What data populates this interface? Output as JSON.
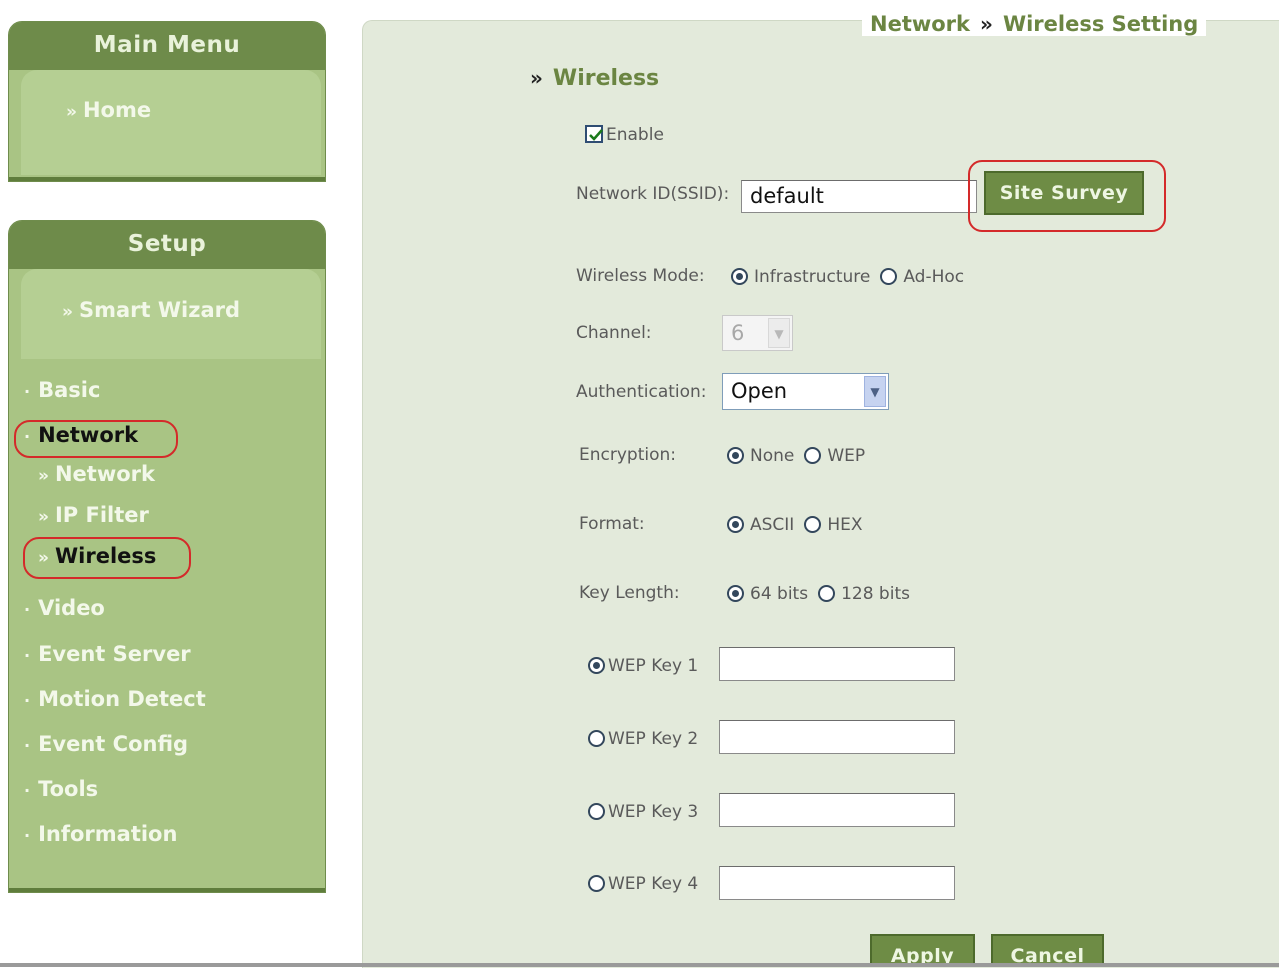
{
  "sidebar": {
    "main_menu": {
      "title": "Main Menu",
      "home_label": "Home"
    },
    "setup": {
      "title": "Setup",
      "wizard_label": "Smart Wizard",
      "items": [
        {
          "label": "Basic"
        },
        {
          "label": "Network"
        },
        {
          "label": "Video"
        },
        {
          "label": "Event Server"
        },
        {
          "label": "Motion Detect"
        },
        {
          "label": "Event Config"
        },
        {
          "label": "Tools"
        },
        {
          "label": "Information"
        }
      ],
      "network_subitems": [
        {
          "label": "Network"
        },
        {
          "label": "IP Filter"
        },
        {
          "label": "Wireless"
        }
      ],
      "nav_chevron": "»",
      "nav_dot": "·"
    }
  },
  "breadcrumb": {
    "section": "Network",
    "separator": "»",
    "page": "Wireless Setting"
  },
  "form": {
    "section_title": "Wireless",
    "section_chevron": "»",
    "enable": {
      "label": "Enable",
      "checked": true
    },
    "ssid": {
      "label": "Network ID(SSID):",
      "value": "default"
    },
    "site_survey_label": "Site Survey",
    "wireless_mode": {
      "label": "Wireless Mode:",
      "options": [
        "Infrastructure",
        "Ad-Hoc"
      ],
      "selected": "Infrastructure"
    },
    "channel": {
      "label": "Channel:",
      "value": "6",
      "disabled": true
    },
    "authentication": {
      "label": "Authentication:",
      "value": "Open"
    },
    "encryption": {
      "label": "Encryption:",
      "options": [
        "None",
        "WEP"
      ],
      "selected": "None"
    },
    "format": {
      "label": "Format:",
      "options": [
        "ASCII",
        "HEX"
      ],
      "selected": "ASCII"
    },
    "key_length": {
      "label": "Key Length:",
      "options": [
        "64 bits",
        "128 bits"
      ],
      "selected": "64 bits"
    },
    "wep_keys": [
      {
        "label": "WEP Key 1",
        "selected": true,
        "value": ""
      },
      {
        "label": "WEP Key 2",
        "selected": false,
        "value": ""
      },
      {
        "label": "WEP Key 3",
        "selected": false,
        "value": ""
      },
      {
        "label": "WEP Key 4",
        "selected": false,
        "value": ""
      }
    ],
    "apply_label": "Apply",
    "cancel_label": "Cancel"
  },
  "colors": {
    "sidebar_header": "#6e8b4a",
    "sidebar_body": "#a9c484",
    "content_bg": "#e3eadb",
    "accent_text": "#6b8542",
    "highlight_ring": "#d42a2a",
    "button_bg": "#6e8c45"
  }
}
